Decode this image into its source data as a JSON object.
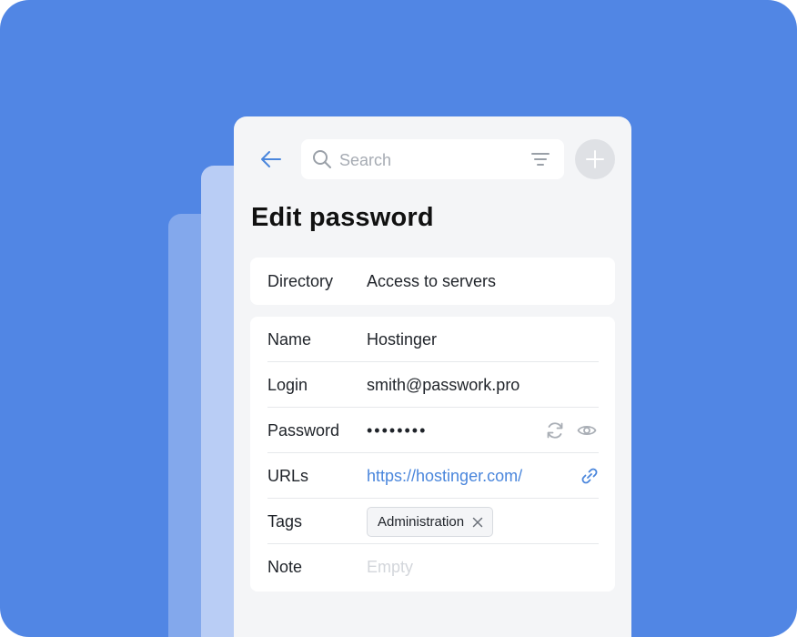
{
  "search": {
    "placeholder": "Search"
  },
  "page": {
    "title": "Edit password"
  },
  "directory": {
    "label": "Directory",
    "value": "Access to servers"
  },
  "fields": {
    "name": {
      "label": "Name",
      "value": "Hostinger"
    },
    "login": {
      "label": "Login",
      "value": "smith@passwork.pro"
    },
    "password": {
      "label": "Password",
      "value": "••••••••"
    },
    "urls": {
      "label": "URLs",
      "value": "https://hostinger.com/"
    },
    "tags": {
      "label": "Tags",
      "items": [
        "Administration"
      ]
    },
    "note": {
      "label": "Note",
      "placeholder": "Empty"
    }
  },
  "icons": {
    "back": "arrow-left-icon",
    "search": "search-icon",
    "filter": "filter-icon",
    "add": "plus-icon",
    "generate": "refresh-icon",
    "reveal": "eye-icon",
    "open_link": "link-icon",
    "remove_tag": "close-icon"
  },
  "colors": {
    "background": "#5186e4",
    "accent": "#4a86dc",
    "card": "#f4f5f7"
  }
}
